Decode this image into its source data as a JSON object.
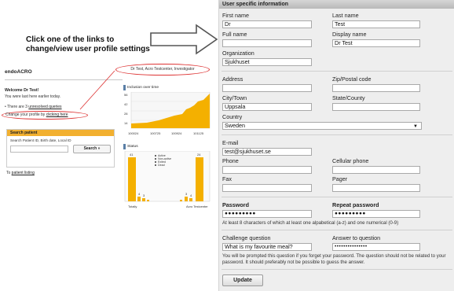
{
  "annotation": {
    "instruction": "Click one of the links to change/view user profile settings"
  },
  "thumbnail": {
    "logo": "endoACRO",
    "user_pill": "Dr Test, Acro Testcenter, Investigator",
    "welcome": "Welcome Dr Test!",
    "last_seen": "You were last here earlier today.",
    "queries_prefix": "• There are 3",
    "queries_link": "unresolved queries",
    "change_profile_prefix": "Change your profile by",
    "change_profile_link": "clicking here",
    "search_patient": {
      "title": "Search patient",
      "label": "Search Patient ID, Birth date, Local ID",
      "button": "Search"
    },
    "patient_listing_prefix": "To",
    "patient_listing_link": "patient listing",
    "inclusion_title": "Inclusion over time",
    "status_title": "Status"
  },
  "form": {
    "header": "User specific information",
    "first_name_label": "First name",
    "first_name": "Dr",
    "last_name_label": "Last name",
    "last_name": "Test",
    "full_name_label": "Full name",
    "full_name": "",
    "display_name_label": "Display name",
    "display_name": "Dr Test",
    "organization_label": "Organization",
    "organization": "Sjukhuset",
    "address_label": "Address",
    "address": "",
    "zip_label": "Zip/Postal code",
    "zip": "",
    "city_label": "City/Town",
    "city": "Uppsala",
    "state_label": "State/County",
    "state": "",
    "country_label": "Country",
    "country": "Sweden",
    "email_label": "E-mail",
    "email": "test@sjukhuset.se",
    "phone_label": "Phone",
    "phone": "",
    "cellular_label": "Cellular phone",
    "cellular": "",
    "fax_label": "Fax",
    "fax": "",
    "pager_label": "Pager",
    "pager": "",
    "password_label": "Password",
    "password": "●●●●●●●●●",
    "repeat_password_label": "Repeat password",
    "repeat_password": "●●●●●●●●●",
    "password_hint": "At least 8 characters of which at least one alpabetical (a-z) and one numerical (0-9)",
    "challenge_label": "Challenge question",
    "challenge": "What is my favourite meal?",
    "answer_label": "Answer to question",
    "answer": "•••••••••••••••",
    "challenge_hint": "You will be prompted this question if you forget your password. The question should not be related to your password. It should preferably not be possible to guess the answer.",
    "update_button": "Update"
  },
  "colors": {
    "highlight_red": "#dd3333",
    "chart_orange": "#f4b000",
    "panel_bg": "#eeeeee"
  }
}
